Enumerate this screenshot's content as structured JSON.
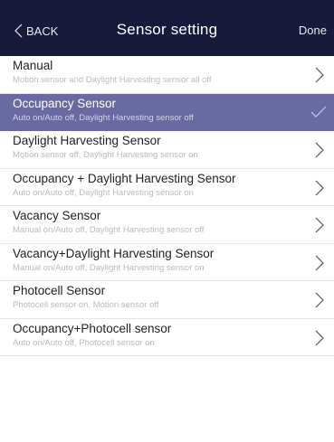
{
  "header": {
    "back_label": "BACK",
    "title": "Sensor setting",
    "done_label": "Done"
  },
  "items": [
    {
      "title": "Manual",
      "subtitle": "Motion sensor and Daylight Harvesting sensor all off",
      "selected": false
    },
    {
      "title": "Occupancy Sensor",
      "subtitle": "Auto on/Auto off, Daylight Harvesting sensor off",
      "selected": true
    },
    {
      "title": "Daylight Harvesting Sensor",
      "subtitle": "Motion sensor off,  Daylight Harvesting sensor on",
      "selected": false
    },
    {
      "title": "Occupancy + Daylight Harvesting Sensor",
      "subtitle": "Auto on/Auto off, Daylight Harvesting sensor on",
      "selected": false
    },
    {
      "title": "Vacancy Sensor",
      "subtitle": "Manual on/Auto off, Daylight Harvesting sensor off",
      "selected": false
    },
    {
      "title": "Vacancy+Daylight Harvesting Sensor",
      "subtitle": "Manual on/Auto off, Daylight Harvesting sensor on",
      "selected": false
    },
    {
      "title": "Photocell Sensor",
      "subtitle": "Photocell sensor on, Motion sensor off",
      "selected": false
    },
    {
      "title": "Occupancy+Photocell sensor",
      "subtitle": "Auto on/Auto off, Photocell sensor on",
      "selected": false
    }
  ],
  "icons": {
    "back": "chevron-left-icon",
    "row_arrow": "chevron-right-icon",
    "selected_mark": "checkmark-icon"
  },
  "colors": {
    "header_bg": "#171a3a",
    "selected_bg": "#6a6aa3",
    "divider": "#e6e6ea"
  }
}
